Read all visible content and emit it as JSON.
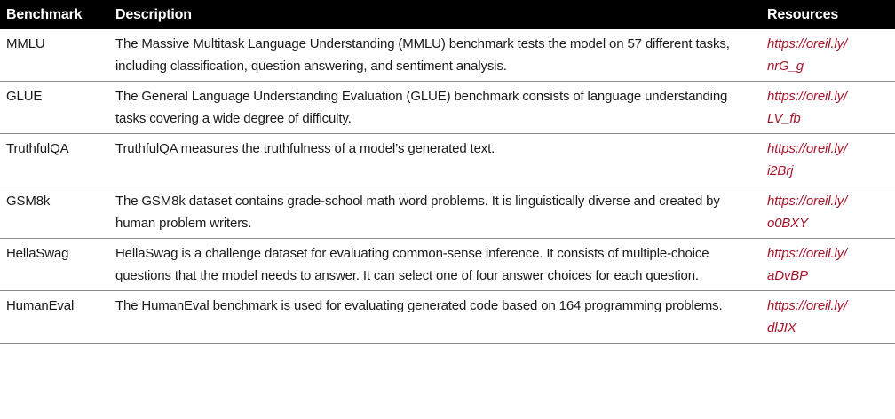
{
  "table": {
    "headers": {
      "benchmark": "Benchmark",
      "description": "Description",
      "resources": "Resources"
    },
    "rows": [
      {
        "benchmark": "MMLU",
        "description": "The Massive Multitask Language Understanding (MMLU) benchmark tests the model on 57 different tasks, including classification, question answering, and sentiment analysis.",
        "link_line1": "https://oreil.ly/",
        "link_line2": "nrG_g"
      },
      {
        "benchmark": "GLUE",
        "description": "The General Language Understanding Evaluation (GLUE) benchmark consists of language understanding tasks covering a wide degree of difficulty.",
        "link_line1": "https://oreil.ly/",
        "link_line2": "LV_fb"
      },
      {
        "benchmark": "TruthfulQA",
        "description": "TruthfulQA measures the truthfulness of a model’s generated text.",
        "link_line1": "https://oreil.ly/",
        "link_line2": "i2Brj"
      },
      {
        "benchmark": "GSM8k",
        "description": "The GSM8k dataset contains grade-school math word problems. It is linguistically diverse and created by human problem writers.",
        "link_line1": "https://oreil.ly/",
        "link_line2": "o0BXY"
      },
      {
        "benchmark": "HellaSwag",
        "description": "HellaSwag is a challenge dataset for evaluating common-sense inference. It consists of multiple-choice questions that the model needs to answer. It can select one of four answer choices for each question.",
        "link_line1": "https://oreil.ly/",
        "link_line2": "aDvBP"
      },
      {
        "benchmark": "HumanEval",
        "description": "The HumanEval benchmark is used for evaluating generated code based on 164 programming problems.",
        "link_line1": "https://oreil.ly/",
        "link_line2": "dlJIX"
      }
    ]
  },
  "colors": {
    "header_bg": "#000000",
    "header_text": "#ffffff",
    "link": "#a5162b",
    "rule": "#8c8c8c"
  }
}
